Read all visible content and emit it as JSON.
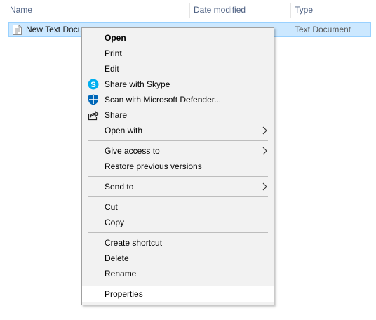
{
  "columns": {
    "name": "Name",
    "date_modified": "Date modified",
    "type": "Type"
  },
  "file": {
    "name": "New Text Document",
    "visible_name": "New Text Docu",
    "type": "Text Document"
  },
  "menu": {
    "open": "Open",
    "print": "Print",
    "edit": "Edit",
    "share_skype": "Share with Skype",
    "scan_defender": "Scan with Microsoft Defender...",
    "share": "Share",
    "open_with": "Open with",
    "give_access": "Give access to",
    "restore_versions": "Restore previous versions",
    "send_to": "Send to",
    "cut": "Cut",
    "copy": "Copy",
    "create_shortcut": "Create shortcut",
    "delete": "Delete",
    "rename": "Rename",
    "properties": "Properties"
  },
  "colors": {
    "selection": "#cce8ff",
    "selection_border": "#99d1ff",
    "menu_bg": "#f2f2f2",
    "skype": "#00aff0",
    "defender": "#0067b8"
  }
}
